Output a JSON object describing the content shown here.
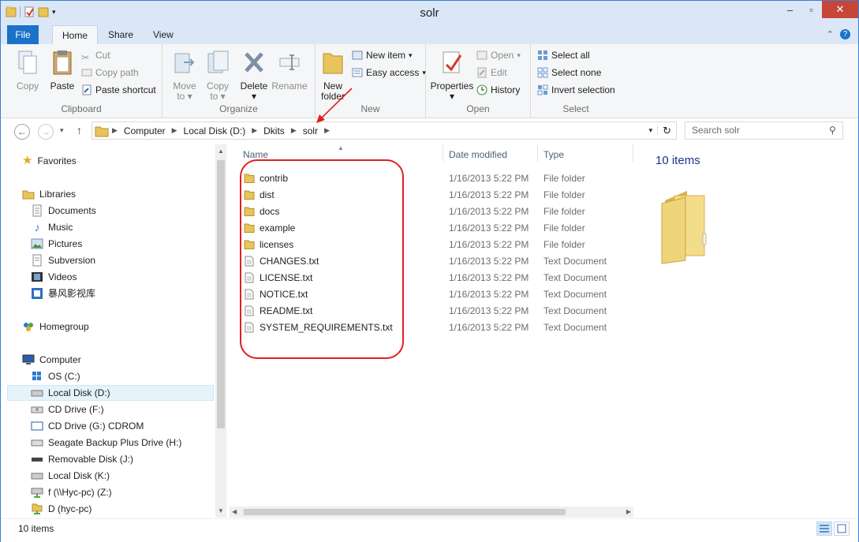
{
  "window": {
    "title": "solr"
  },
  "tabs": {
    "file": "File",
    "home": "Home",
    "share": "Share",
    "view": "View"
  },
  "ribbon": {
    "clipboard": {
      "label": "Clipboard",
      "copy": "Copy",
      "paste": "Paste",
      "cut": "Cut",
      "copy_path": "Copy path",
      "paste_shortcut": "Paste shortcut"
    },
    "organize": {
      "label": "Organize",
      "move_to": "Move",
      "move_to2": "to",
      "copy_to": "Copy",
      "copy_to2": "to",
      "delete": "Delete",
      "rename": "Rename"
    },
    "new": {
      "label": "New",
      "new_folder": "New",
      "new_folder2": "folder",
      "new_item": "New item",
      "easy_access": "Easy access"
    },
    "open": {
      "label": "Open",
      "properties": "Properties",
      "open": "Open",
      "edit": "Edit",
      "history": "History"
    },
    "select": {
      "label": "Select",
      "select_all": "Select all",
      "select_none": "Select none",
      "invert_selection": "Invert selection"
    }
  },
  "address": {
    "crumbs": [
      "Computer",
      "Local Disk (D:)",
      "Dkits",
      "solr"
    ],
    "search_placeholder": "Search solr"
  },
  "nav": {
    "favorites": "Favorites",
    "libraries": "Libraries",
    "library_items": [
      "Documents",
      "Music",
      "Pictures",
      "Subversion",
      "Videos",
      "暴风影视库"
    ],
    "homegroup": "Homegroup",
    "computer": "Computer",
    "drives": [
      "OS (C:)",
      "Local Disk (D:)",
      "CD Drive (F:)",
      "CD Drive (G:) CDROM",
      "Seagate Backup Plus Drive (H:)",
      "Removable Disk (J:)",
      "Local Disk (K:)",
      "f (\\\\Hyc-pc) (Z:)",
      "D (hyc-pc)"
    ]
  },
  "columns": {
    "name": "Name",
    "date": "Date modified",
    "type": "Type"
  },
  "files": [
    {
      "name": "contrib",
      "date": "1/16/2013 5:22 PM",
      "type": "File folder",
      "kind": "folder"
    },
    {
      "name": "dist",
      "date": "1/16/2013 5:22 PM",
      "type": "File folder",
      "kind": "folder"
    },
    {
      "name": "docs",
      "date": "1/16/2013 5:22 PM",
      "type": "File folder",
      "kind": "folder"
    },
    {
      "name": "example",
      "date": "1/16/2013 5:22 PM",
      "type": "File folder",
      "kind": "folder"
    },
    {
      "name": "licenses",
      "date": "1/16/2013 5:22 PM",
      "type": "File folder",
      "kind": "folder"
    },
    {
      "name": "CHANGES.txt",
      "date": "1/16/2013 5:22 PM",
      "type": "Text Document",
      "kind": "text"
    },
    {
      "name": "LICENSE.txt",
      "date": "1/16/2013 5:22 PM",
      "type": "Text Document",
      "kind": "text"
    },
    {
      "name": "NOTICE.txt",
      "date": "1/16/2013 5:22 PM",
      "type": "Text Document",
      "kind": "text"
    },
    {
      "name": "README.txt",
      "date": "1/16/2013 5:22 PM",
      "type": "Text Document",
      "kind": "text"
    },
    {
      "name": "SYSTEM_REQUIREMENTS.txt",
      "date": "1/16/2013 5:22 PM",
      "type": "Text Document",
      "kind": "text"
    }
  ],
  "preview": {
    "count": "10 items"
  },
  "status": {
    "count": "10 items"
  },
  "colors": {
    "accent": "#1a72c9",
    "annotation": "#e02020",
    "folder": "#e8c45a"
  }
}
